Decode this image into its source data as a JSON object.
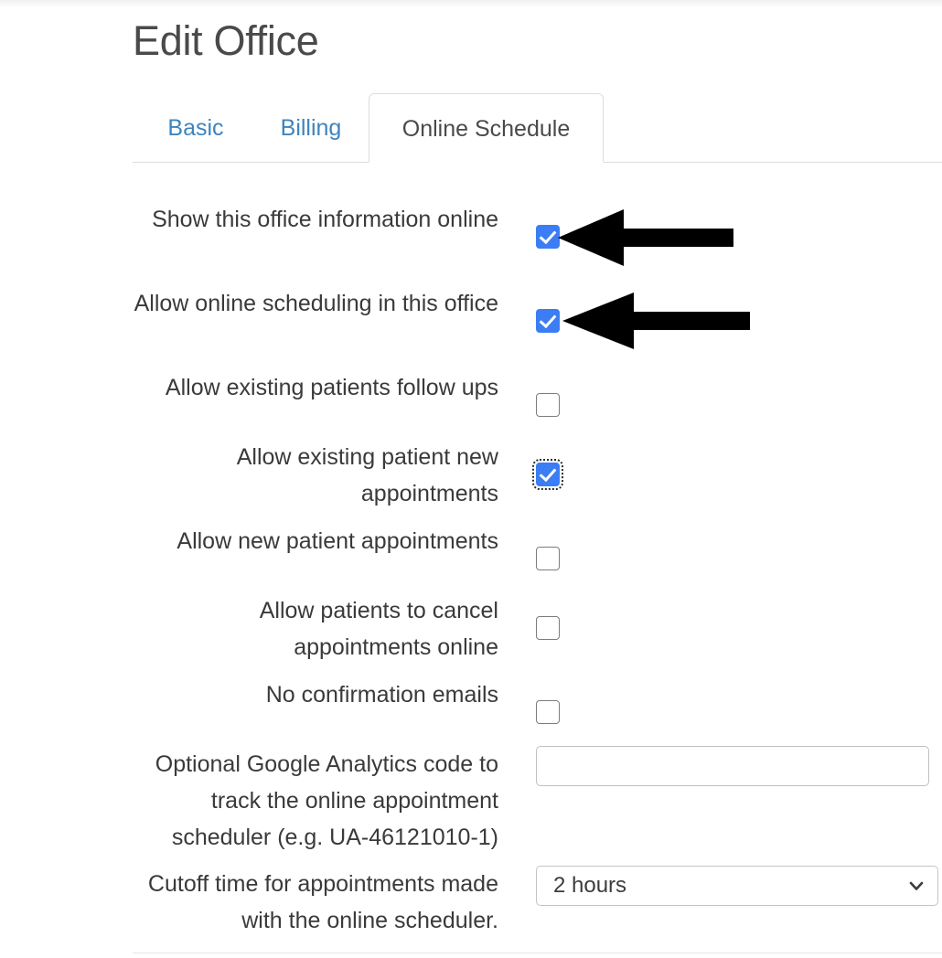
{
  "page": {
    "title": "Edit Office"
  },
  "tabs": [
    {
      "label": "Basic",
      "active": false
    },
    {
      "label": "Billing",
      "active": false
    },
    {
      "label": "Online Schedule",
      "active": true
    }
  ],
  "form": {
    "rows": [
      {
        "label": "Show this office information online",
        "control": "checkbox",
        "checked": true,
        "focused": false,
        "annotated": true
      },
      {
        "label": "Allow online scheduling in this office",
        "control": "checkbox",
        "checked": true,
        "focused": false,
        "annotated": true
      },
      {
        "label": "Allow existing patients follow ups",
        "control": "checkbox",
        "checked": false,
        "focused": false,
        "annotated": false
      },
      {
        "label": "Allow existing patient new appointments",
        "control": "checkbox",
        "checked": true,
        "focused": true,
        "annotated": false
      },
      {
        "label": "Allow new patient appointments",
        "control": "checkbox",
        "checked": false,
        "focused": false,
        "annotated": false
      },
      {
        "label": "Allow patients to cancel appointments online",
        "control": "checkbox",
        "checked": false,
        "focused": false,
        "annotated": false
      },
      {
        "label": "No confirmation emails",
        "control": "checkbox",
        "checked": false,
        "focused": false,
        "annotated": false
      },
      {
        "label": "Optional Google Analytics code to track the online appointment scheduler (e.g. UA-46121010-1)",
        "control": "text",
        "value": "",
        "placeholder": ""
      },
      {
        "label": "Cutoff time for appointments made with the online scheduler.",
        "control": "select",
        "value": "2 hours"
      }
    ]
  },
  "icons": {
    "chevron_down": "chevron-down-icon",
    "checkmark": "checkmark-icon",
    "arrow_left": "arrow-left-icon"
  },
  "colors": {
    "checkbox_checked": "#3b7df4",
    "tab_link": "#3d84be",
    "text": "#3a3a3a",
    "border": "#dddddd",
    "annotation_arrow": "#000000"
  }
}
